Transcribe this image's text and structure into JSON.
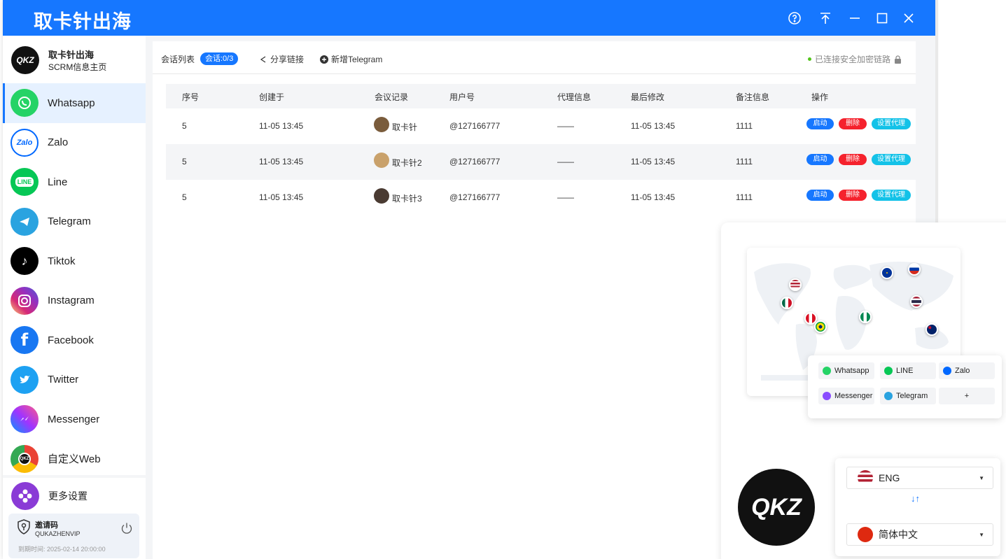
{
  "window": {
    "title": "取卡针出海",
    "controls": [
      "help-icon",
      "pin-top-icon",
      "minimize-icon",
      "maximize-icon",
      "close-icon"
    ]
  },
  "brand": {
    "logo_text": "QKZ",
    "name": "取卡针出海",
    "subtitle": "SCRM信息主页"
  },
  "sidebar": {
    "items": [
      {
        "label": "Whatsapp",
        "icon": "whatsapp-icon",
        "color": "#25d366",
        "active": true
      },
      {
        "label": "Zalo",
        "icon": "zalo-icon",
        "color": "#0068ff",
        "active": false
      },
      {
        "label": "Line",
        "icon": "line-icon",
        "color": "#06c755",
        "active": false
      },
      {
        "label": "Telegram",
        "icon": "telegram-icon",
        "color": "#2aa3e0",
        "active": false
      },
      {
        "label": "Tiktok",
        "icon": "tiktok-icon",
        "color": "#000000",
        "active": false
      },
      {
        "label": "Instagram",
        "icon": "instagram-icon",
        "color": "#e1306c",
        "active": false
      },
      {
        "label": "Facebook",
        "icon": "facebook-icon",
        "color": "#1877f2",
        "active": false
      },
      {
        "label": "Twitter",
        "icon": "twitter-icon",
        "color": "#1da1f2",
        "active": false
      },
      {
        "label": "Messenger",
        "icon": "messenger-icon",
        "color": "#8a4dff",
        "active": false
      },
      {
        "label": "自定义Web",
        "icon": "custom-web-icon",
        "color": "#ea4335",
        "active": false
      }
    ],
    "settings_label": "更多设置",
    "invite": {
      "title": "邀请码",
      "code": "QUKAZHENVIP",
      "expiry": "到期时间: 2025-02-14 20:00:00"
    }
  },
  "toolbar": {
    "session_list": "会话列表",
    "session_badge": "会话:0/3",
    "share_link": "分享链接",
    "add_telegram": "新增Telegram",
    "secure_text": "已连接安全加密链路"
  },
  "table": {
    "headers": [
      "序号",
      "创建于",
      "会议记录",
      "用户号",
      "代理信息",
      "最后修改",
      "备注信息",
      "操作"
    ],
    "rows": [
      {
        "index": "5",
        "created": "11-05 13:45",
        "name": "取卡针",
        "user": "@127166777",
        "proxy": "——",
        "modified": "11-05 13:45",
        "note": "1111"
      },
      {
        "index": "5",
        "created": "11-05 13:45",
        "name": "取卡针2",
        "user": "@127166777",
        "proxy": "——",
        "modified": "11-05 13:45",
        "note": "1111"
      },
      {
        "index": "5",
        "created": "11-05 13:45",
        "name": "取卡针3",
        "user": "@127166777",
        "proxy": "——",
        "modified": "11-05 13:45",
        "note": "1111"
      }
    ],
    "actions": {
      "start": "启动",
      "delete": "删除",
      "proxy": "设置代理"
    }
  },
  "promo": {
    "apps": [
      "Whatsapp",
      "LINE",
      "Zalo",
      "Messenger",
      "Telegram",
      "+"
    ],
    "badge_text": "QKZ",
    "lang_from": "ENG",
    "lang_to": "简体中文",
    "swap": "↓↑"
  }
}
